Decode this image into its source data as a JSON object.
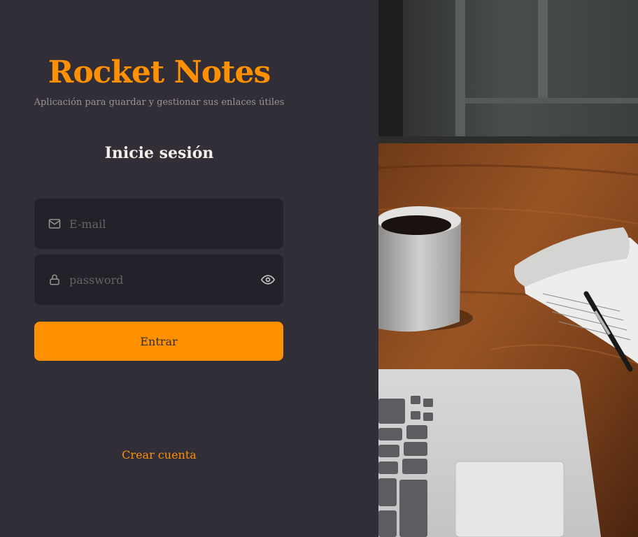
{
  "brand": {
    "title": "Rocket Notes",
    "subtitle": "Aplicación para guardar y gestionar sus enlaces útiles"
  },
  "form": {
    "heading": "Inicie sesión",
    "email": {
      "placeholder": "E-mail",
      "icon": "mail-icon"
    },
    "password": {
      "placeholder": "password",
      "icon": "lock-icon",
      "toggle_icon": "eye-icon"
    },
    "submit_label": "Entrar"
  },
  "footer": {
    "create_account": "Crear cuenta"
  },
  "colors": {
    "background": "#312E38",
    "input_bg": "#232129",
    "accent": "#FF9000",
    "text": "#F4EDE8",
    "muted": "#999591",
    "placeholder": "#666360"
  },
  "hero": {
    "image": "desk-photo"
  }
}
